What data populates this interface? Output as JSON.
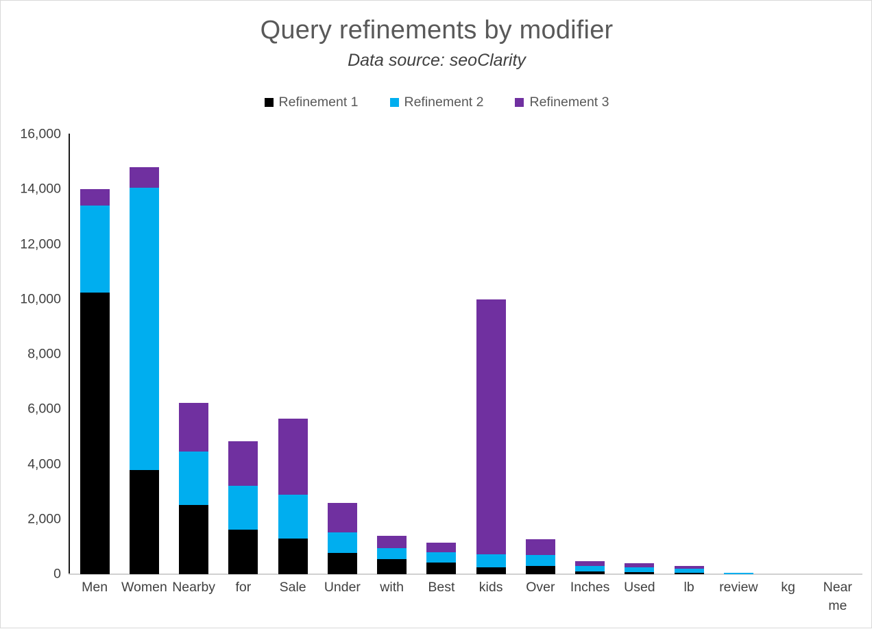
{
  "chart_data": {
    "type": "bar",
    "title": "Query refinements by modifier",
    "subtitle": "Data source: seoClarity",
    "xlabel": "",
    "ylabel": "",
    "stacked": true,
    "grid": false,
    "legend_position": "top",
    "ylim": [
      0,
      16000
    ],
    "yticks": [
      0,
      2000,
      4000,
      6000,
      8000,
      10000,
      12000,
      14000,
      16000
    ],
    "ytick_labels": [
      "0",
      "2,000",
      "4,000",
      "6,000",
      "8,000",
      "10,000",
      "12,000",
      "14,000",
      "16,000"
    ],
    "categories": [
      "Men",
      "Women",
      "Nearby",
      "for",
      "Sale",
      "Under",
      "with",
      "Best",
      "kids",
      "Over",
      "Inches",
      "Used",
      "lb",
      "review",
      "kg",
      "Near me"
    ],
    "series": [
      {
        "name": "Refinement 1",
        "color": "#000000",
        "values": [
          10250,
          3780,
          2520,
          1620,
          1290,
          770,
          560,
          430,
          250,
          290,
          100,
          80,
          60,
          0,
          0,
          0
        ]
      },
      {
        "name": "Refinement 2",
        "color": "#00AEEF",
        "values": [
          3150,
          10270,
          1940,
          1600,
          1600,
          750,
          390,
          370,
          470,
          410,
          200,
          170,
          130,
          60,
          0,
          0
        ]
      },
      {
        "name": "Refinement 3",
        "color": "#7030A0",
        "values": [
          600,
          750,
          1770,
          1610,
          2780,
          1070,
          450,
          340,
          9280,
          570,
          170,
          150,
          110,
          0,
          0,
          0
        ]
      }
    ],
    "totals": [
      14000,
      14800,
      6230,
      4830,
      5670,
      2590,
      1400,
      1140,
      10000,
      1270,
      470,
      400,
      300,
      60,
      0,
      0
    ]
  },
  "colors": {
    "refinement_1": "#000000",
    "refinement_2": "#00AEEF",
    "refinement_3": "#7030A0",
    "title": "#595959",
    "axis_text": "#404040",
    "axis_line": "#1a1a1a",
    "border": "#d9d9d9",
    "background": "#ffffff"
  }
}
